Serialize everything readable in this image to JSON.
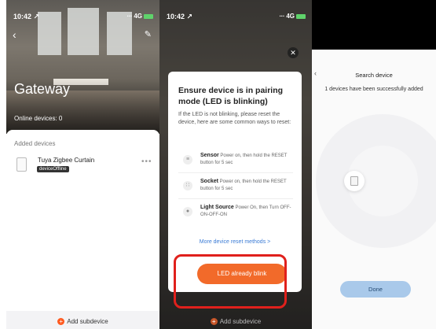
{
  "panel1": {
    "status_time": "10:42 ↗",
    "status_right": "∙∙∙ 4G",
    "title": "Gateway",
    "online_devices": "Online devices: 0",
    "added_devices_label": "Added devices",
    "device": {
      "name": "Tuya Zigbee Curtain",
      "status": "deviceOffline"
    },
    "more": "•••",
    "add_subdevice": "Add subdevice"
  },
  "panel2": {
    "status_time": "10:42 ↗",
    "status_right": "∙∙∙ 4G",
    "card_title": "Ensure device is in pairing mode (LED is blinking)",
    "card_desc": "If the LED is not blinking, please reset the device, here are some common ways to reset:",
    "rows": [
      {
        "name": "Sensor",
        "desc": "Power on, then hold the RESET button for 5 sec"
      },
      {
        "name": "Socket",
        "desc": "Power on, then hold the RESET button for 5 sec"
      },
      {
        "name": "Light Source",
        "desc": "Power On, then Turn OFF-ON-OFF-ON"
      }
    ],
    "more_link": "More device reset methods >",
    "led_button": "LED already blink",
    "add_subdevice": "Add subdevice"
  },
  "panel3": {
    "title": "Search device",
    "message": "1 devices have been successfully added",
    "done": "Done"
  },
  "colors": {
    "accent": "#f26a2a",
    "highlight": "#e0201c",
    "link": "#3a7bd5",
    "done_button": "#a9c9ea"
  }
}
